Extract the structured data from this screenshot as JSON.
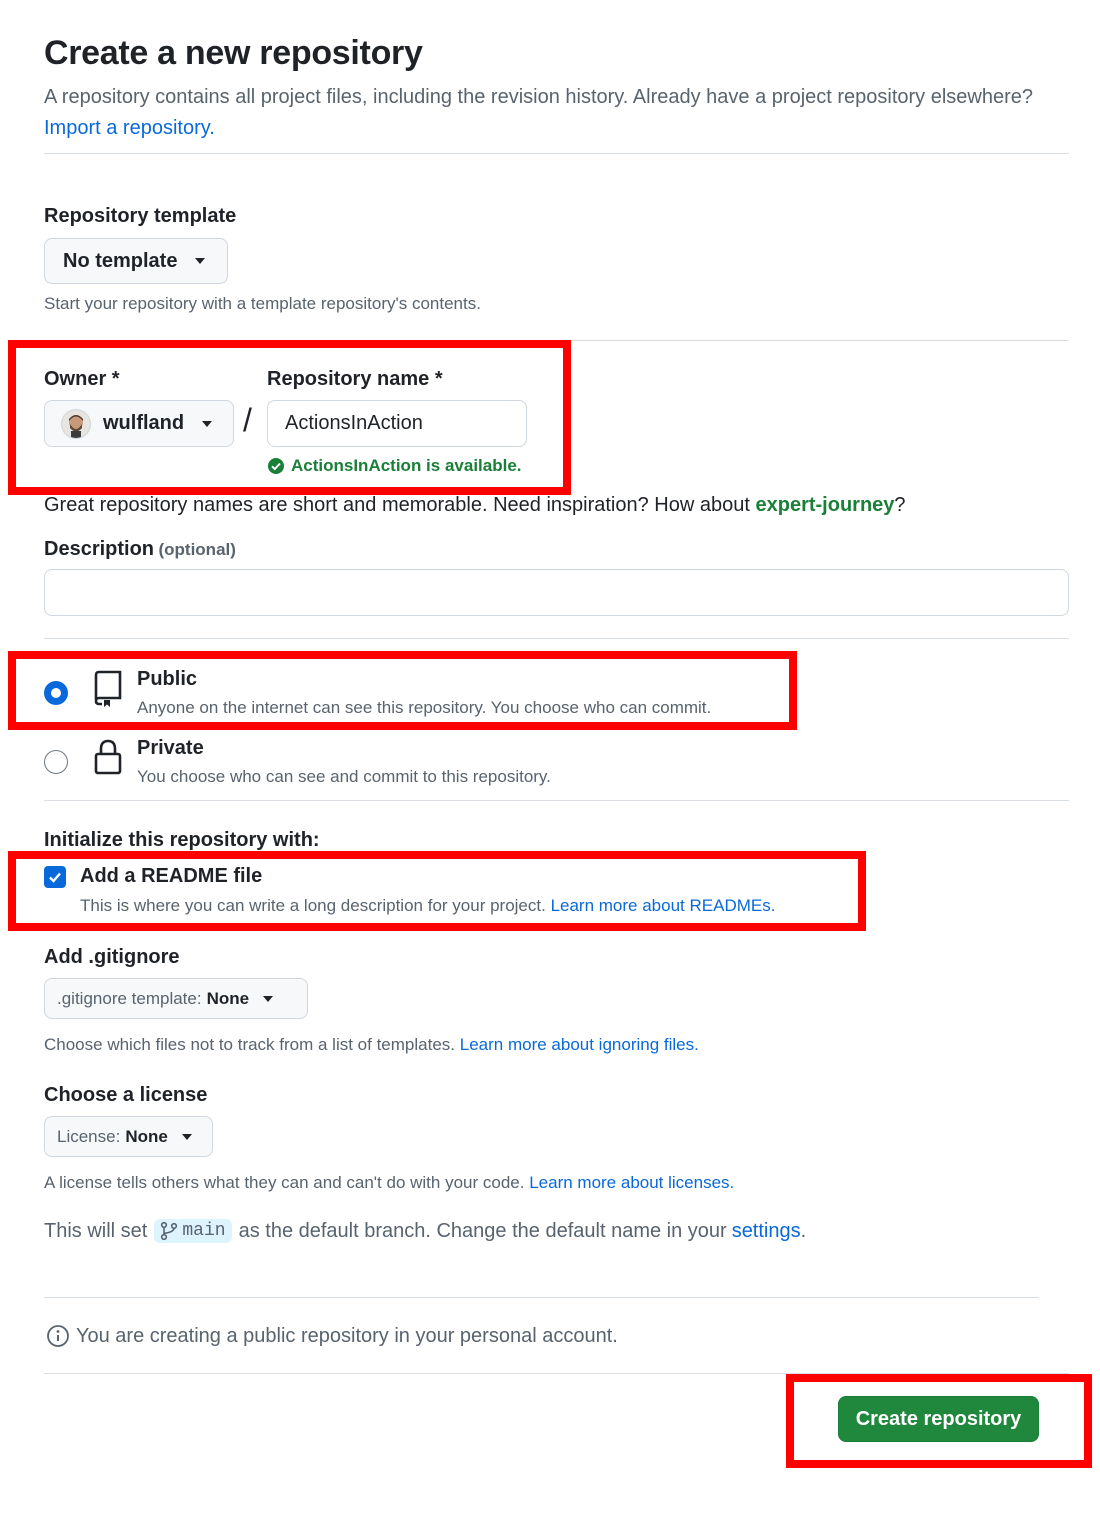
{
  "header": {
    "title": "Create a new repository",
    "intro": "A repository contains all project files, including the revision history. Already have a project repository elsewhere?",
    "import_link": "Import a repository."
  },
  "template": {
    "label": "Repository template",
    "selected": "No template",
    "note": "Start your repository with a template repository's contents."
  },
  "owner": {
    "label": "Owner *",
    "selected": "wulfland",
    "separator": "/"
  },
  "repo_name": {
    "label": "Repository name *",
    "value": "ActionsInAction",
    "availability": "ActionsInAction is available."
  },
  "suggestion": {
    "text": "Great repository names are short and memorable. Need inspiration? How about",
    "suggested_name": "expert-journey",
    "end": "?"
  },
  "description": {
    "label": "Description",
    "optional": "(optional)",
    "value": ""
  },
  "visibility": {
    "public": {
      "title": "Public",
      "desc": "Anyone on the internet can see this repository. You choose who can commit.",
      "selected": true
    },
    "private": {
      "title": "Private",
      "desc": "You choose who can see and commit to this repository.",
      "selected": false
    }
  },
  "init": {
    "heading": "Initialize this repository with:",
    "readme": {
      "label": "Add a README file",
      "desc": "This is where you can write a long description for your project.",
      "link": "Learn more about READMEs.",
      "checked": true
    }
  },
  "gitignore": {
    "label": "Add .gitignore",
    "prefix": ".gitignore template:",
    "selected": "None",
    "note": "Choose which files not to track from a list of templates.",
    "link": "Learn more about ignoring files."
  },
  "license": {
    "label": "Choose a license",
    "prefix": "License:",
    "selected": "None",
    "note": "A license tells others what they can and can't do with your code.",
    "link": "Learn more about licenses."
  },
  "branch": {
    "prefix": "This will set",
    "name": "main",
    "suffix": "as the default branch. Change the default name in your",
    "settings_link": "settings",
    "end": "."
  },
  "info": {
    "text": "You are creating a public repository in your personal account."
  },
  "submit": {
    "label": "Create repository"
  },
  "colors": {
    "accent": "#0969da",
    "success": "#1a7f37",
    "primary_button": "#1f883d",
    "highlight": "#ff0000"
  },
  "icons": [
    "caret-down-icon",
    "avatar",
    "check-circle-icon",
    "repo-icon",
    "lock-icon",
    "checkmark-icon",
    "git-branch-icon",
    "info-icon"
  ]
}
